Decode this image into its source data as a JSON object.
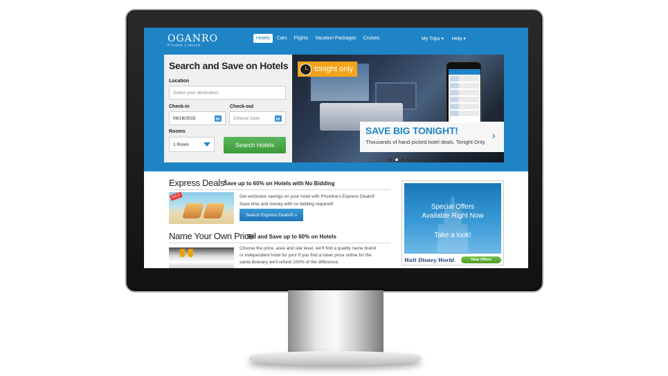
{
  "brand": {
    "name": "OGANRO",
    "tagline": "Private Limited"
  },
  "nav": {
    "items": [
      "Hotels",
      "Cars",
      "Flights",
      "Vacation Packages",
      "Cruises"
    ],
    "active": "Hotels",
    "right": [
      "My Trips ▾",
      "Help ▾"
    ]
  },
  "search": {
    "title": "Search and Save on Hotels",
    "location_label": "Location",
    "location_placeholder": "Select your destination",
    "checkin_label": "Check-in",
    "checkin_value": "08/18/2015",
    "checkout_label": "Check-out",
    "checkout_placeholder": "Choose Date",
    "rooms_label": "Rooms",
    "rooms_value": "1 Room",
    "button": "Search Hotels"
  },
  "hero": {
    "badge": "tonight only",
    "headline": "SAVE BIG TONIGHT!",
    "subline": "Thousands of hand-picked hotel deals, Tonight Only",
    "slides": 7,
    "active_slide": 2
  },
  "express": {
    "title": "Express Deals",
    "reg": "®",
    "subtitle": "Save up to 60% on Hotels with No Bidding",
    "badge": "SALE",
    "line1": "Get exclusive savings on your hotel with Priceline's Express Deals®",
    "line2": "Save time and money with no bidding required!",
    "button": "Search Express Deals® »"
  },
  "nyop": {
    "title": "Name Your Own Price",
    "reg": "®",
    "subtitle": "Bid and Save up to 60% on Hotels",
    "line1": "Choose the price, area and star level, we'll find a quality name brand",
    "line2": "or independent hotel for you! If you find a lower price online for the",
    "line3": "same itinerary we'll refund 100% of the difference."
  },
  "ad": {
    "line1": "Special Offers",
    "line2": "Available Right Now",
    "line3": "Take a look!",
    "brand": "Walt Disney World.",
    "button": "View Offers"
  },
  "colors": {
    "primary": "#1e84c6",
    "search_button": "#3a9a3a",
    "badge": "#f5a31a"
  }
}
